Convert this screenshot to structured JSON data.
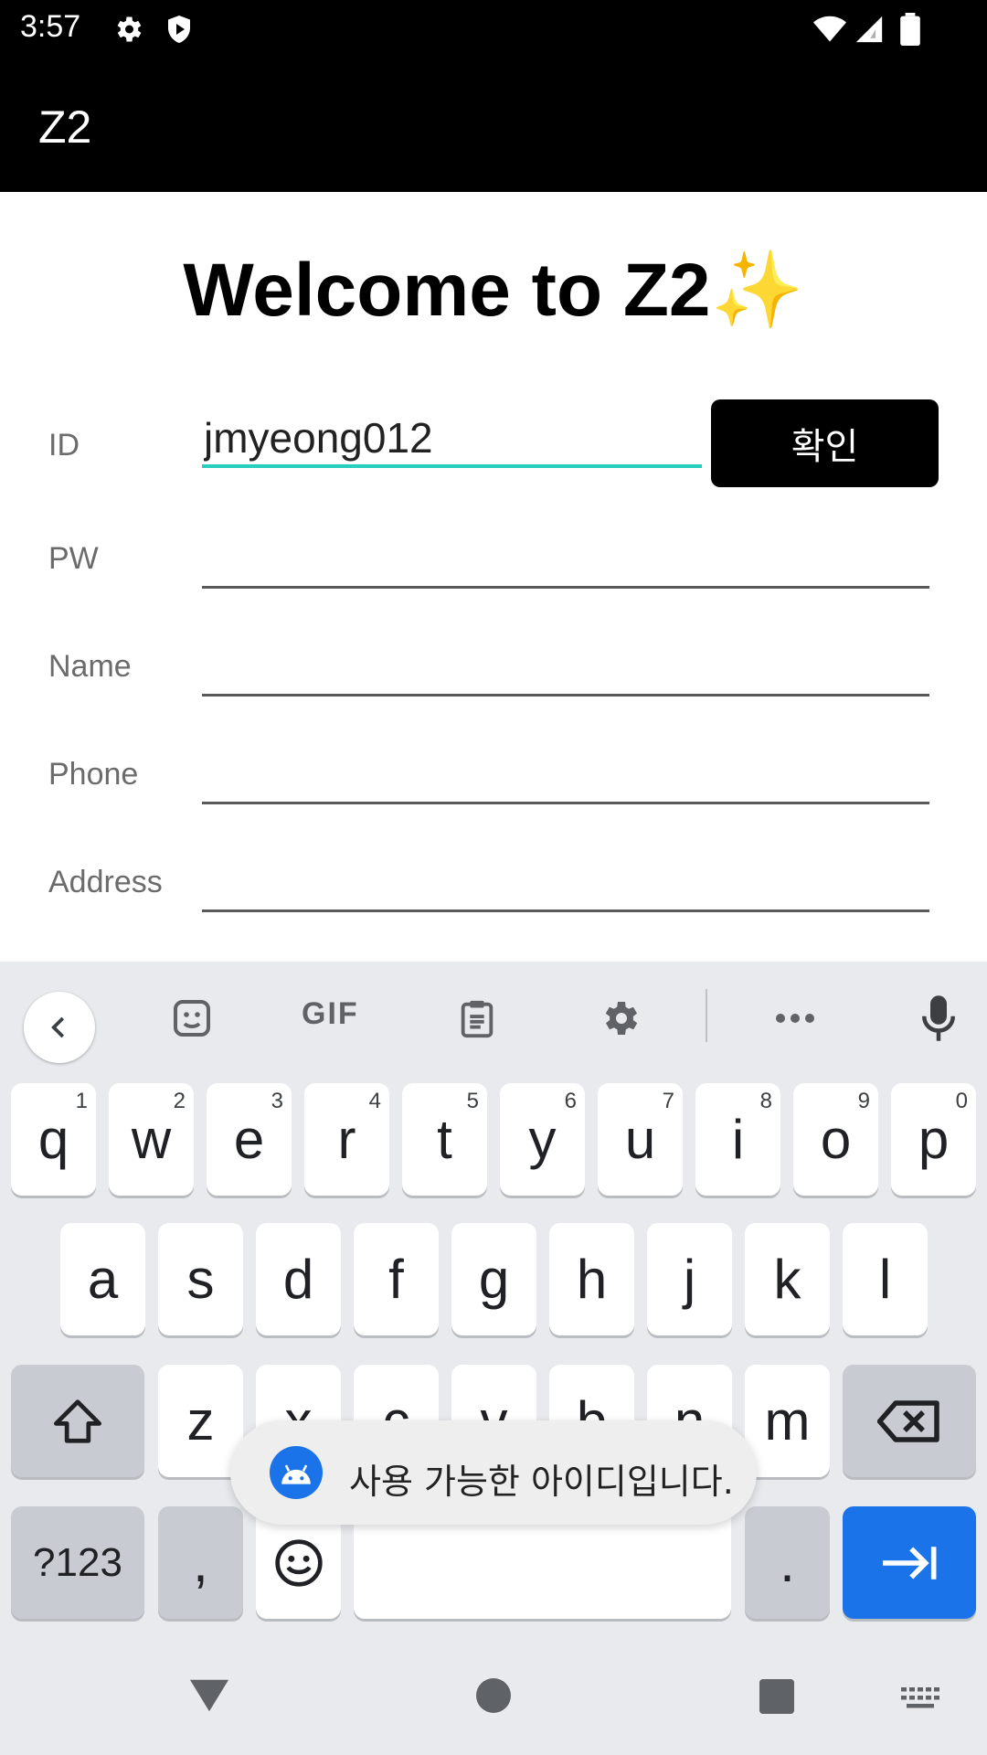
{
  "status_bar": {
    "time": "3:57",
    "icons": [
      "gear-icon",
      "shield-icon",
      "wifi-icon",
      "signal-icon",
      "battery-icon"
    ]
  },
  "app_bar": {
    "title": "Z2"
  },
  "form": {
    "welcome": "Welcome to Z2",
    "welcome_emoji": "✨",
    "fields": [
      {
        "label": "ID",
        "value": "jmyeong012"
      },
      {
        "label": "PW",
        "value": ""
      },
      {
        "label": "Name",
        "value": ""
      },
      {
        "label": "Phone",
        "value": ""
      },
      {
        "label": "Address",
        "value": ""
      }
    ],
    "confirm_label": "확인"
  },
  "keyboard": {
    "toolbar": {
      "gif_label": "GIF"
    },
    "row1": [
      {
        "key": "q",
        "hint": "1"
      },
      {
        "key": "w",
        "hint": "2"
      },
      {
        "key": "e",
        "hint": "3"
      },
      {
        "key": "r",
        "hint": "4"
      },
      {
        "key": "t",
        "hint": "5"
      },
      {
        "key": "y",
        "hint": "6"
      },
      {
        "key": "u",
        "hint": "7"
      },
      {
        "key": "i",
        "hint": "8"
      },
      {
        "key": "o",
        "hint": "9"
      },
      {
        "key": "p",
        "hint": "0"
      }
    ],
    "row2": [
      "a",
      "s",
      "d",
      "f",
      "g",
      "h",
      "j",
      "k",
      "l"
    ],
    "row3": [
      "z",
      "x",
      "c",
      "v",
      "b",
      "n",
      "m"
    ],
    "row4": {
      "symbols": "?123",
      "comma": ",",
      "period": "."
    }
  },
  "toast": {
    "message": "사용 가능한 아이디입니다."
  },
  "colors": {
    "accent": "#26cfc0",
    "keyboard_blue": "#1a73e8",
    "bar": "#000000"
  }
}
